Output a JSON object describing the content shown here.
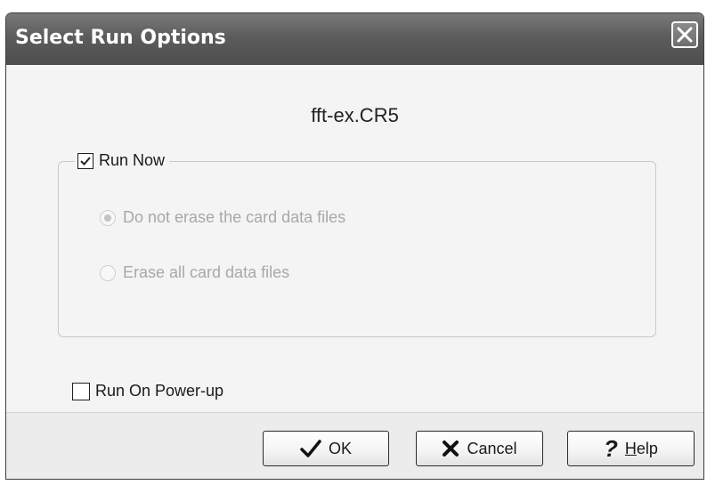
{
  "window": {
    "title": "Select Run Options"
  },
  "content": {
    "filename": "fft-ex.CR5",
    "run_now": {
      "label": "Run Now",
      "checked": true
    },
    "radio_options": [
      {
        "label": "Do not erase the card data files",
        "selected": true,
        "enabled": false
      },
      {
        "label": "Erase all card data files",
        "selected": false,
        "enabled": false
      }
    ],
    "run_on_powerup": {
      "label": "Run On Power-up",
      "checked": false
    }
  },
  "buttons": {
    "ok": {
      "label": "OK",
      "icon": "checkmark-icon"
    },
    "cancel": {
      "label": "Cancel",
      "icon": "x-icon"
    },
    "help": {
      "mnemonic": "H",
      "label_rest": "elp",
      "icon": "question-mark-icon"
    }
  }
}
